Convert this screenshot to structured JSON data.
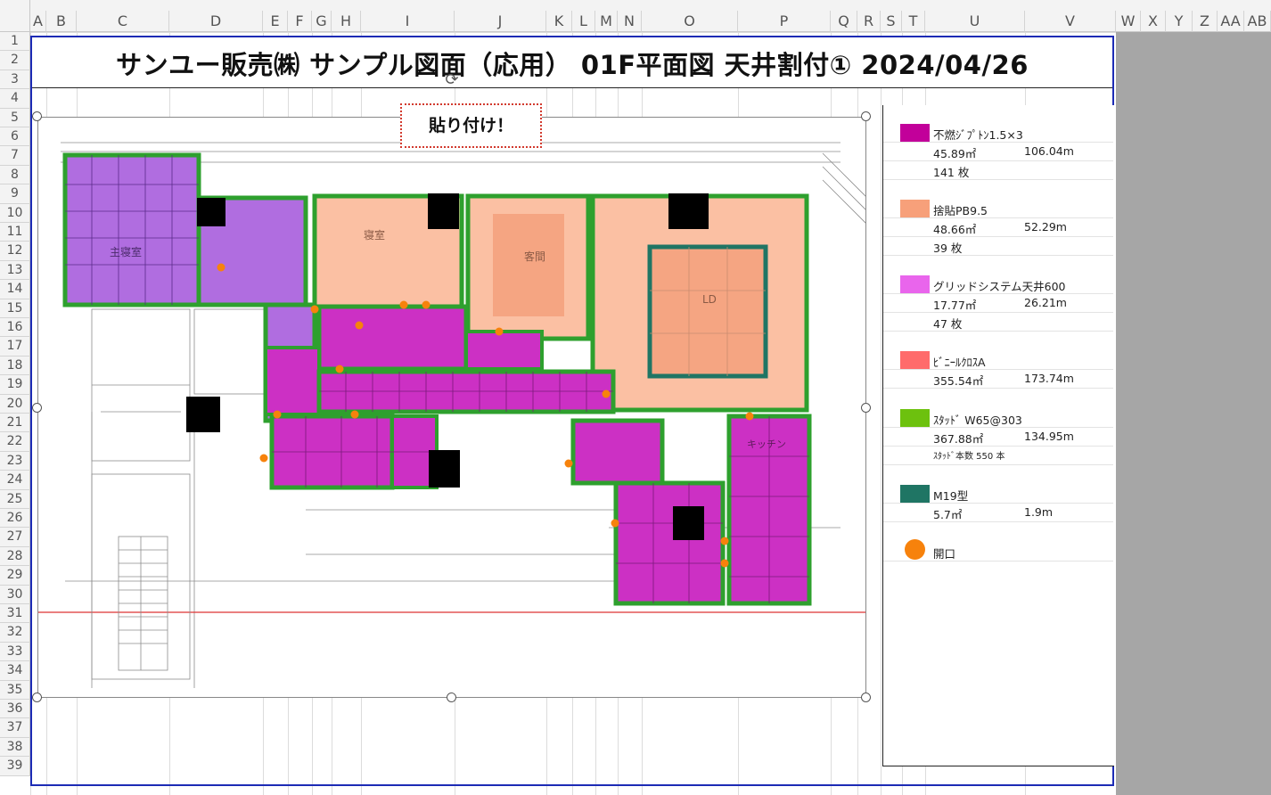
{
  "columns": [
    "A",
    "B",
    "C",
    "D",
    "E",
    "F",
    "G",
    "H",
    "I",
    "J",
    "K",
    "L",
    "M",
    "N",
    "O",
    "P",
    "Q",
    "R",
    "S",
    "T",
    "U",
    "V",
    "W",
    "X",
    "Y",
    "Z",
    "AA",
    "AB"
  ],
  "rows": [
    "1",
    "2",
    "3",
    "4",
    "5",
    "6",
    "7",
    "8",
    "9",
    "10",
    "11",
    "12",
    "13",
    "14",
    "15",
    "16",
    "17",
    "18",
    "19",
    "20",
    "21",
    "22",
    "23",
    "24",
    "25",
    "26",
    "27",
    "28",
    "29",
    "30",
    "31",
    "32",
    "33",
    "34",
    "35",
    "36",
    "37",
    "38",
    "39"
  ],
  "title": "サンユー販売㈱ サンプル図面（応用） 01F平面図 天井割付① 2024/04/26",
  "callout": "貼り付け！",
  "floorplan": {
    "room_labels": [
      "主寝室",
      "寝室",
      "客間",
      "LD",
      "キッチン"
    ]
  },
  "legend": [
    {
      "name": "不燃ｼﾞﾌﾟﾄﾝ1.5×3",
      "color": "#c2009a",
      "area": "45.89㎡",
      "length": "106.04m",
      "count": "141 枚"
    },
    {
      "name": "捨貼PB9.5",
      "color": "#f7a07a",
      "area": "48.66㎡",
      "length": "52.29m",
      "count": "39 枚"
    },
    {
      "name": "グリッドシステム天井600",
      "color": "#e965ec",
      "area": "17.77㎡",
      "length": "26.21m",
      "count": "47 枚"
    },
    {
      "name": "ﾋﾞﾆｰﾙｸﾛｽA",
      "color": "#ff6b6b",
      "area": "355.54㎡",
      "length": "173.74m",
      "count": ""
    },
    {
      "name": "ｽﾀｯﾄﾞ W65@303",
      "color": "#6dc10e",
      "area": "367.88㎡",
      "length": "134.95m",
      "count": "ｽﾀｯﾄﾞ本数 550 本"
    },
    {
      "name": "M19型",
      "color": "#1f7564",
      "area": "5.7㎡",
      "length": "1.9m",
      "count": ""
    },
    {
      "name": "開口",
      "color": "#f7820c",
      "area": "",
      "length": "",
      "count": ""
    }
  ]
}
